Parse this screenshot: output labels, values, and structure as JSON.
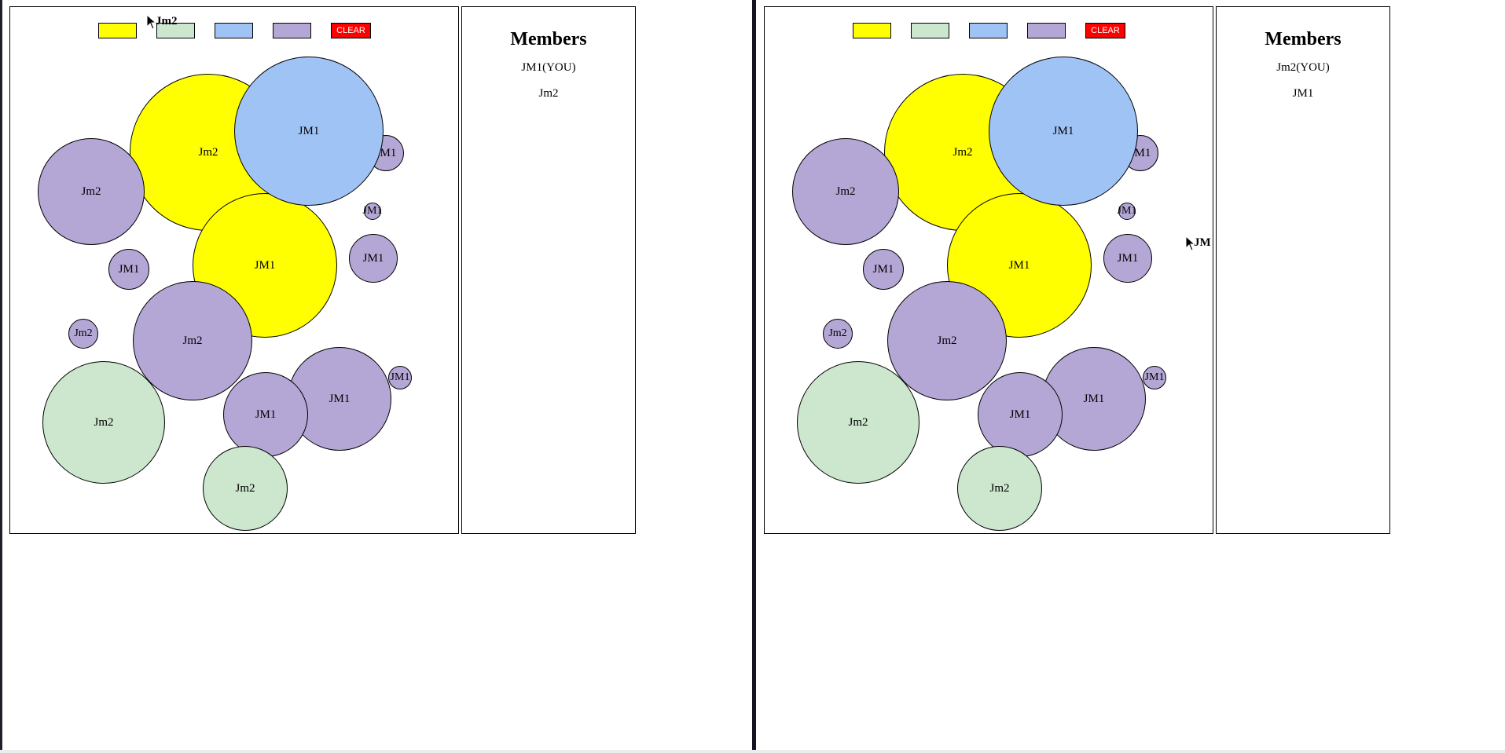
{
  "colors": {
    "yellow": "#ffff00",
    "green": "#cce7cd",
    "blue": "#a0c3f6",
    "purple": "#b4a7d6",
    "clear": "#ff0000"
  },
  "panes": [
    {
      "toolbar": {
        "swatches": [
          {
            "name": "yellow-swatch",
            "color": "#ffff00"
          },
          {
            "name": "green-swatch",
            "color": "#cce7cd"
          },
          {
            "name": "blue-swatch",
            "color": "#a0c3f6"
          },
          {
            "name": "purple-swatch",
            "color": "#b4a7d6"
          }
        ],
        "clear_label": "CLEAR"
      },
      "circles": [
        {
          "label": "Jm2",
          "color": "#ffff00"
        },
        {
          "label": "JM1",
          "color": "#ffff00"
        },
        {
          "label": "JM1",
          "color": "#b4a7d6"
        },
        {
          "label": "JM1",
          "color": "#a0c3f6"
        },
        {
          "label": "Jm2",
          "color": "#b4a7d6"
        },
        {
          "label": "JM1",
          "color": "#b4a7d6"
        },
        {
          "label": "JM1",
          "color": "#b4a7d6"
        },
        {
          "label": "JM1",
          "color": "#b4a7d6"
        },
        {
          "label": "Jm2",
          "color": "#b4a7d6"
        },
        {
          "label": "Jm2",
          "color": "#b4a7d6"
        },
        {
          "label": "JM1",
          "color": "#b4a7d6"
        },
        {
          "label": "JM1",
          "color": "#b4a7d6"
        },
        {
          "label": "JM1",
          "color": "#b4a7d6"
        },
        {
          "label": "Jm2",
          "color": "#cce7cd"
        },
        {
          "label": "Jm2",
          "color": "#cce7cd"
        }
      ],
      "members_title": "Members",
      "members": [
        "JM1(YOU)",
        "Jm2"
      ],
      "remote_cursor_label": "Jm2"
    },
    {
      "toolbar": {
        "swatches": [
          {
            "name": "yellow-swatch",
            "color": "#ffff00"
          },
          {
            "name": "green-swatch",
            "color": "#cce7cd"
          },
          {
            "name": "blue-swatch",
            "color": "#a0c3f6"
          },
          {
            "name": "purple-swatch",
            "color": "#b4a7d6"
          }
        ],
        "clear_label": "CLEAR"
      },
      "circles": [
        {
          "label": "Jm2",
          "color": "#ffff00"
        },
        {
          "label": "JM1",
          "color": "#ffff00"
        },
        {
          "label": "JM1",
          "color": "#b4a7d6"
        },
        {
          "label": "JM1",
          "color": "#a0c3f6"
        },
        {
          "label": "Jm2",
          "color": "#b4a7d6"
        },
        {
          "label": "JM1",
          "color": "#b4a7d6"
        },
        {
          "label": "JM1",
          "color": "#b4a7d6"
        },
        {
          "label": "JM1",
          "color": "#b4a7d6"
        },
        {
          "label": "Jm2",
          "color": "#b4a7d6"
        },
        {
          "label": "Jm2",
          "color": "#b4a7d6"
        },
        {
          "label": "JM1",
          "color": "#b4a7d6"
        },
        {
          "label": "JM1",
          "color": "#b4a7d6"
        },
        {
          "label": "JM1",
          "color": "#b4a7d6"
        },
        {
          "label": "Jm2",
          "color": "#cce7cd"
        },
        {
          "label": "Jm2",
          "color": "#cce7cd"
        }
      ],
      "members_title": "Members",
      "members": [
        "Jm2(YOU)",
        "JM1"
      ],
      "remote_cursor_label": "JM"
    }
  ]
}
